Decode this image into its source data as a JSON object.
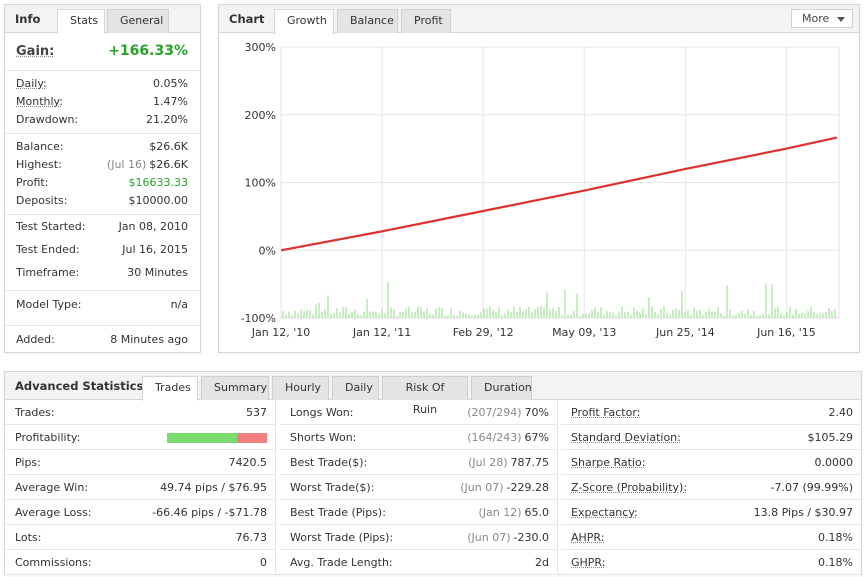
{
  "info": {
    "title": "Info",
    "tabs": [
      "Stats",
      "General"
    ],
    "gain_label": "Gain:",
    "gain_value": "+166.33%",
    "rows1": [
      {
        "label": "Daily:",
        "value": "0.05%"
      },
      {
        "label": "Monthly:",
        "value": "1.47%"
      },
      {
        "label": "Drawdown:",
        "value": "21.20%"
      }
    ],
    "rows2": [
      {
        "label": "Balance:",
        "muted": "",
        "value": "$26.6K"
      },
      {
        "label": "Highest:",
        "muted": "(Jul 16)",
        "value": "$26.6K"
      },
      {
        "label": "Profit:",
        "muted": "",
        "value": "$16633.33"
      },
      {
        "label": "Deposits:",
        "muted": "",
        "value": "$10000.00"
      }
    ],
    "rows3": [
      {
        "label": "Test Started:",
        "value": "Jan 08, 2010"
      },
      {
        "label": "Test Ended:",
        "value": "Jul 16, 2015"
      },
      {
        "label": "Timeframe:",
        "value": "30 Minutes"
      }
    ],
    "rows4": [
      {
        "label": "Model Type:",
        "value": "n/a"
      }
    ],
    "rows5": [
      {
        "label": "Added:",
        "value": "8 Minutes ago"
      }
    ]
  },
  "chart_panel": {
    "title": "Chart",
    "tabs": [
      "Growth",
      "Balance",
      "Profit"
    ],
    "more_label": "More"
  },
  "chart_data": {
    "type": "line",
    "title": "",
    "xlabel": "",
    "ylabel": "",
    "ylim": [
      -100,
      300
    ],
    "yticks": [
      "300%",
      "200%",
      "100%",
      "0%",
      "-100%"
    ],
    "xticks": [
      "Jan 12, '10",
      "Jan 12, '11",
      "Feb 29, '12",
      "May 09, '13",
      "Jun 25, '14",
      "Jun 16, '15"
    ],
    "series": [
      {
        "name": "",
        "color": "#e0312c",
        "x": [
          0,
          1,
          2,
          3,
          4,
          5,
          5.5
        ],
        "values": [
          0,
          28,
          58,
          88,
          120,
          150,
          166.33
        ]
      }
    ],
    "bar_color": "#8ddc80",
    "grid": true
  },
  "advanced": {
    "title": "Advanced Statistics",
    "tabs": [
      "Trades",
      "Summary",
      "Hourly",
      "Daily",
      "Risk Of Ruin",
      "Duration"
    ],
    "col1": [
      {
        "label": "Trades:",
        "value": "537"
      },
      {
        "label": "Profitability:",
        "value": ""
      },
      {
        "label": "Pips:",
        "value": "7420.5"
      },
      {
        "label": "Average Win:",
        "value": "49.74 pips / $76.95"
      },
      {
        "label": "Average Loss:",
        "value": "-66.46 pips / -$71.78"
      },
      {
        "label": "Lots:",
        "value": "76.73"
      },
      {
        "label": "Commissions:",
        "value": "0"
      }
    ],
    "profitability_win_fraction": 0.7,
    "col2": [
      {
        "label": "Longs Won:",
        "muted": "(207/294)",
        "value": "70%"
      },
      {
        "label": "Shorts Won:",
        "muted": "(164/243)",
        "value": "67%"
      },
      {
        "label": "Best Trade($):",
        "muted": "(Jul 28)",
        "value": "787.75"
      },
      {
        "label": "Worst Trade($):",
        "muted": "(Jun 07)",
        "value": "-229.28"
      },
      {
        "label": "Best Trade (Pips):",
        "muted": "(Jan 12)",
        "value": "65.0"
      },
      {
        "label": "Worst Trade (Pips):",
        "muted": "(Jun 07)",
        "value": "-230.0"
      },
      {
        "label": "Avg. Trade Length:",
        "muted": "",
        "value": "2d"
      }
    ],
    "col3": [
      {
        "label": "Profit Factor:",
        "value": "2.40"
      },
      {
        "label": "Standard Deviation:",
        "value": "$105.29"
      },
      {
        "label": "Sharpe Ratio:",
        "value": "0.0000"
      },
      {
        "label": "Z-Score (Probability):",
        "value": "-7.07 (99.99%)"
      },
      {
        "label": "Expectancy:",
        "value": "13.8 Pips / $30.97"
      },
      {
        "label": "AHPR:",
        "value": "0.18%"
      },
      {
        "label": "GHPR:",
        "value": "0.18%"
      }
    ]
  }
}
